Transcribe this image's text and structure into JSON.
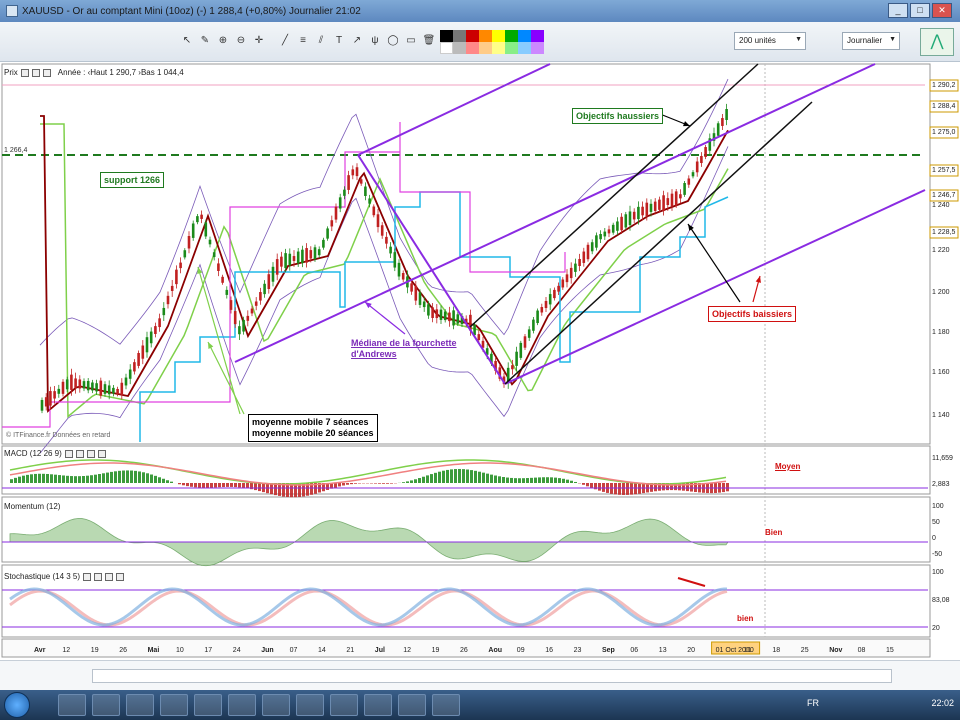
{
  "window": {
    "title": "XAUUSD - Or au comptant Mini (10oz) (-)   1 288,4 (+0,80%)   Journalier  21:02",
    "minimize": "_",
    "maximize": "□",
    "close": "✕"
  },
  "toolbar": {
    "units_select": "200 unités",
    "period_select": "Journalier",
    "icons": [
      "cursor-icon",
      "pencil-icon",
      "zoom-icon",
      "zoom-out-icon",
      "crosshair-icon",
      "trend-line-icon",
      "fibonacci-icon",
      "channel-icon",
      "text-icon",
      "delete-icon",
      "color-swatch-icon"
    ]
  },
  "main_chart": {
    "label": "Prix",
    "legend": "Année : ‹Haut 1 290,7 ›Bas 1 044,4",
    "support_value": "1 266,4",
    "price_ticks": [
      "1 290,2",
      "1 288,4",
      "1 275,0",
      "1 257,5",
      "1 246,7",
      "1 240",
      "1 228,5",
      "1 220",
      "1 200",
      "1 180",
      "1 160",
      "1 140"
    ],
    "annotations": {
      "support": "support 1266",
      "objectifs_haussiers": "Objectifs haussiers",
      "objectifs_baissiers": "Objectifs baissiers",
      "mediane": "Médiane de la fourchette\nd'Andrews",
      "mm_legend_line1": "moyenne mobile 7 séances",
      "mm_legend_line2": "moyenne mobile 20 séances"
    },
    "source": "© ITFinance.fr   Données en retard",
    "colors": {
      "fork": "#8a2be2",
      "channel": "#111111",
      "support_line": "#1f7a1f",
      "ma7": "#8b0000",
      "ma20": "#7fd04a",
      "bollinger": "#7a5ab8",
      "kijun": "#20b8e8",
      "step": "#e040e0",
      "up_candle": "#1a8a1a",
      "down_candle": "#c02020"
    }
  },
  "macd_panel": {
    "label": "MACD (12 26 9)",
    "annotation": "Moyen",
    "ticks": [
      "11,659",
      "2,883"
    ]
  },
  "momentum_panel": {
    "label": "Momentum (12)",
    "annotation": "Bien",
    "ticks": [
      "100",
      "50",
      "0",
      "-50"
    ]
  },
  "stoch_panel": {
    "label": "Stochastique (14 3 5)",
    "annotation": "bien",
    "ticks": [
      "100",
      "83,08",
      "20"
    ]
  },
  "x_axis": {
    "labels": [
      "Avr",
      "12",
      "19",
      "26",
      "Mai",
      "10",
      "17",
      "24",
      "Jun",
      "07",
      "14",
      "21",
      "Jul",
      "12",
      "19",
      "26",
      "Aou",
      "09",
      "16",
      "23",
      "Sep",
      "06",
      "13",
      "20",
      "01 Oct 2010",
      "11",
      "18",
      "25",
      "Nov",
      "08",
      "15"
    ]
  },
  "taskbar": {
    "lang": "FR",
    "clock": "22:02"
  }
}
